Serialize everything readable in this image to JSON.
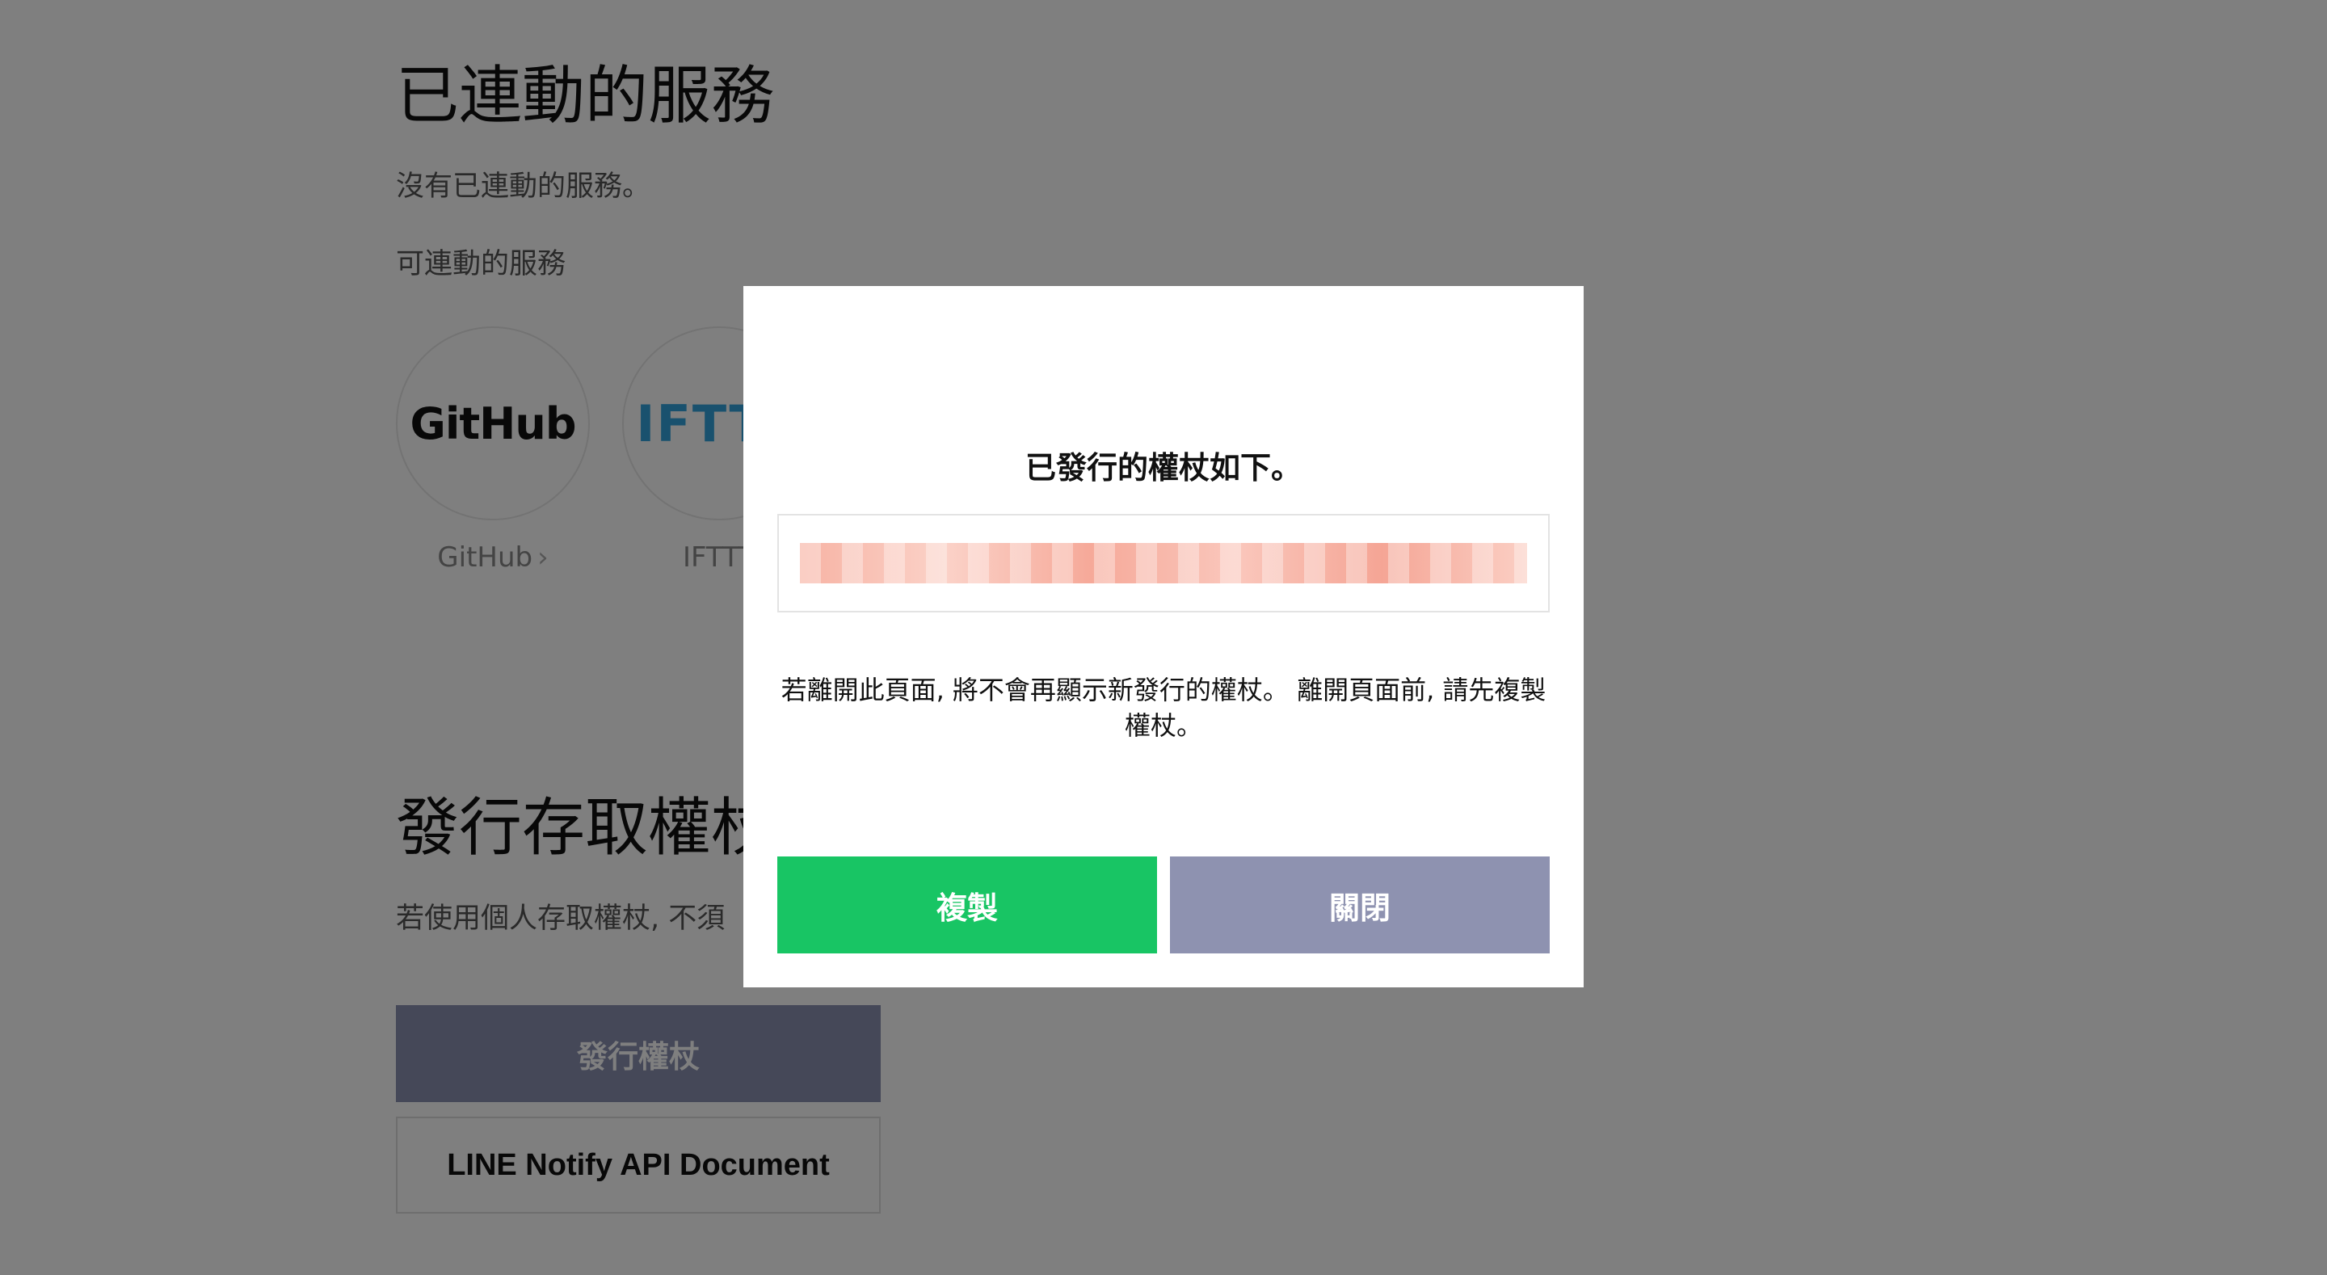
{
  "connected": {
    "title": "已連動的服務",
    "empty_text": "沒有已連動的服務。",
    "available_label": "可連動的服務"
  },
  "services": [
    {
      "logo": "GitHub",
      "label": "GitHub",
      "chevron": "›"
    },
    {
      "logo": "IFTTT",
      "label": "IFTTT"
    }
  ],
  "issue": {
    "title": "發行存取權杖",
    "desc": "若使用個人存取權杖, 不須",
    "issue_button": "發行權杖",
    "doc_button": "LINE Notify API Document"
  },
  "modal": {
    "title": "已發行的權杖如下。",
    "token_value": "",
    "note": "若離開此頁面, 將不會再顯示新發行的權杖。 離開頁面前, 請先複製權杖。",
    "copy_button": "複製",
    "close_button": "關閉"
  },
  "colors": {
    "overlay": "rgba(0,0,0,0.5)",
    "copy_green": "#18c564",
    "close_gray": "#8e92b0",
    "issue_button": "#8a90b0",
    "ifttt_blue": "#33a3dc"
  }
}
